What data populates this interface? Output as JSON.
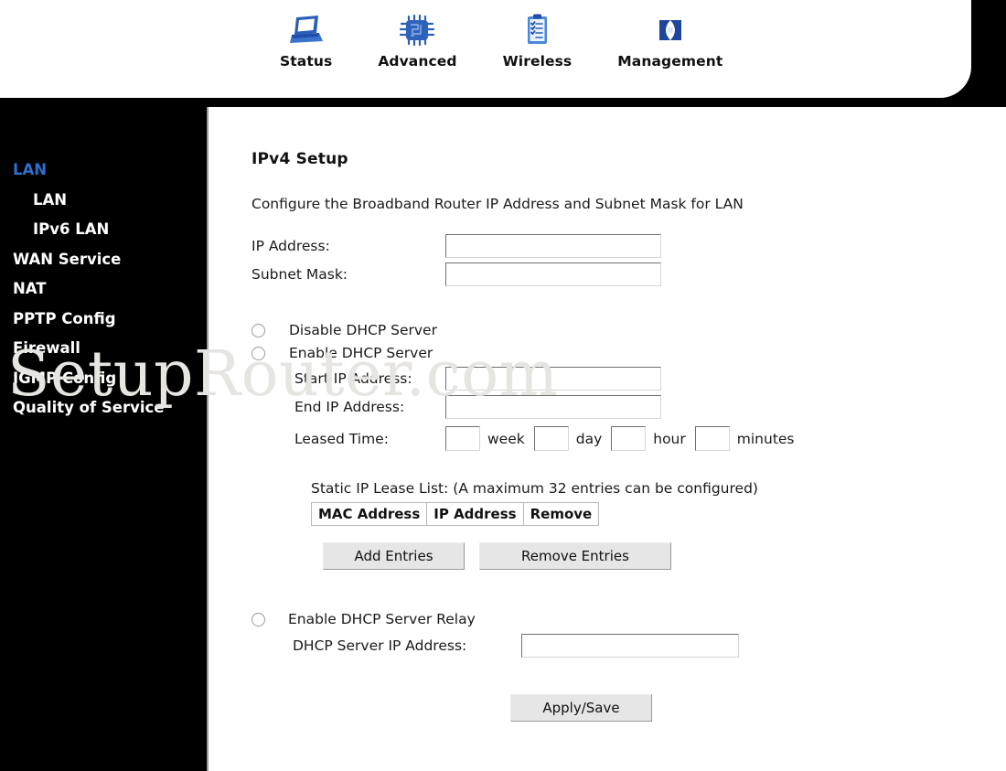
{
  "nav": {
    "items": [
      {
        "label": "Status",
        "icon": "laptop-icon"
      },
      {
        "label": "Advanced",
        "icon": "chip-icon"
      },
      {
        "label": "Wireless",
        "icon": "clipboard-icon"
      },
      {
        "label": "Management",
        "icon": "folder-icon"
      }
    ]
  },
  "sidebar": {
    "items": [
      {
        "label": "LAN",
        "active": true,
        "sub": false
      },
      {
        "label": "LAN",
        "active": false,
        "sub": true
      },
      {
        "label": "IPv6 LAN",
        "active": false,
        "sub": true
      },
      {
        "label": "WAN Service",
        "active": false,
        "sub": false
      },
      {
        "label": "NAT",
        "active": false,
        "sub": false
      },
      {
        "label": "PPTP Config",
        "active": false,
        "sub": false
      },
      {
        "label": "Firewall",
        "active": false,
        "sub": false
      },
      {
        "label": "IGMP Config",
        "active": false,
        "sub": false
      },
      {
        "label": "Quality of Service",
        "active": false,
        "sub": false
      }
    ]
  },
  "main": {
    "title": "IPv4 Setup",
    "subtitle": "Configure the Broadband Router IP Address and Subnet Mask for LAN",
    "ip_address_label": "IP Address:",
    "ip_address_value": "",
    "subnet_mask_label": "Subnet Mask:",
    "subnet_mask_value": "",
    "disable_dhcp_label": "Disable DHCP Server",
    "enable_dhcp_label": "Enable DHCP Server",
    "start_ip_label": "Start IP Address:",
    "start_ip_value": "",
    "end_ip_label": "End IP Address:",
    "end_ip_value": "",
    "leased_time_label": "Leased Time:",
    "leased_week_value": "",
    "leased_week_unit": "week",
    "leased_day_value": "",
    "leased_day_unit": "day",
    "leased_hour_value": "",
    "leased_hour_unit": "hour",
    "leased_minutes_value": "",
    "leased_minutes_unit": "minutes",
    "lease_list_label": "Static IP Lease List: (A maximum 32 entries can be configured)",
    "lease_table": {
      "columns": [
        "MAC Address",
        "IP Address",
        "Remove"
      ],
      "rows": []
    },
    "add_entries_label": "Add Entries",
    "remove_entries_label": "Remove Entries",
    "enable_relay_label": "Enable DHCP Server Relay",
    "relay_ip_label": "DHCP Server IP Address:",
    "relay_ip_value": "",
    "apply_save_label": "Apply/Save"
  },
  "watermark": {
    "text": "SetupRouter.com"
  },
  "colors": {
    "accent": "#2f6fd0",
    "sidebar_bg": "#000000",
    "panel_bg": "#ffffff",
    "icon_blue": "#1f4fa8"
  }
}
